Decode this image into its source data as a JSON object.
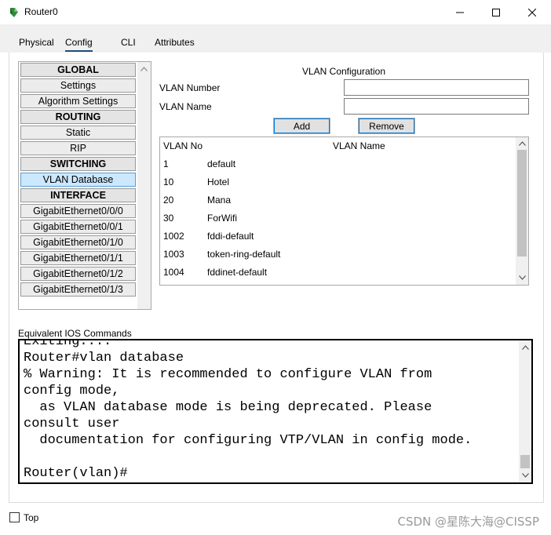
{
  "window": {
    "title": "Router0",
    "icon": "router-icon"
  },
  "window_controls": {
    "minimize": "minimize-icon",
    "maximize": "maximize-icon",
    "close": "close-icon"
  },
  "tabs": [
    {
      "label": "Physical"
    },
    {
      "label": "Config",
      "active": true
    },
    {
      "label": "CLI"
    },
    {
      "label": "Attributes"
    }
  ],
  "sidebar": {
    "items": [
      {
        "label": "GLOBAL",
        "type": "section"
      },
      {
        "label": "Settings"
      },
      {
        "label": "Algorithm Settings"
      },
      {
        "label": "ROUTING",
        "type": "section"
      },
      {
        "label": "Static"
      },
      {
        "label": "RIP"
      },
      {
        "label": "SWITCHING",
        "type": "section"
      },
      {
        "label": "VLAN Database",
        "selected": true
      },
      {
        "label": "INTERFACE",
        "type": "section"
      },
      {
        "label": "GigabitEthernet0/0/0"
      },
      {
        "label": "GigabitEthernet0/0/1"
      },
      {
        "label": "GigabitEthernet0/1/0"
      },
      {
        "label": "GigabitEthernet0/1/1"
      },
      {
        "label": "GigabitEthernet0/1/2"
      },
      {
        "label": "GigabitEthernet0/1/3"
      }
    ]
  },
  "vlan_config": {
    "title": "VLAN Configuration",
    "number_label": "VLAN Number",
    "number_value": "",
    "name_label": "VLAN Name",
    "name_value": "",
    "add_label": "Add",
    "remove_label": "Remove",
    "table": {
      "headers": [
        "VLAN No",
        "VLAN Name"
      ],
      "rows": [
        [
          "1",
          "default"
        ],
        [
          "10",
          "Hotel"
        ],
        [
          "20",
          "Mana"
        ],
        [
          "30",
          "ForWifi"
        ],
        [
          "1002",
          "fddi-default"
        ],
        [
          "1003",
          "token-ring-default"
        ],
        [
          "1004",
          "fddinet-default"
        ]
      ]
    }
  },
  "ios": {
    "label": "Equivalent IOS Commands",
    "lines": [
      "Exiting....",
      "Router#vlan database",
      "% Warning: It is recommended to configure VLAN from",
      "config mode,",
      "  as VLAN database mode is being deprecated. Please",
      "consult user",
      "  documentation for configuring VTP/VLAN in config mode.",
      "",
      "Router(vlan)#"
    ]
  },
  "footer": {
    "top_label": "Top",
    "top_checked": false
  },
  "watermark": "CSDN @星陈大海@CISSP",
  "colors": {
    "selected_bg": "#cce8ff",
    "button_focus": "#0078d7",
    "tab_underline": "#1e4e79"
  }
}
